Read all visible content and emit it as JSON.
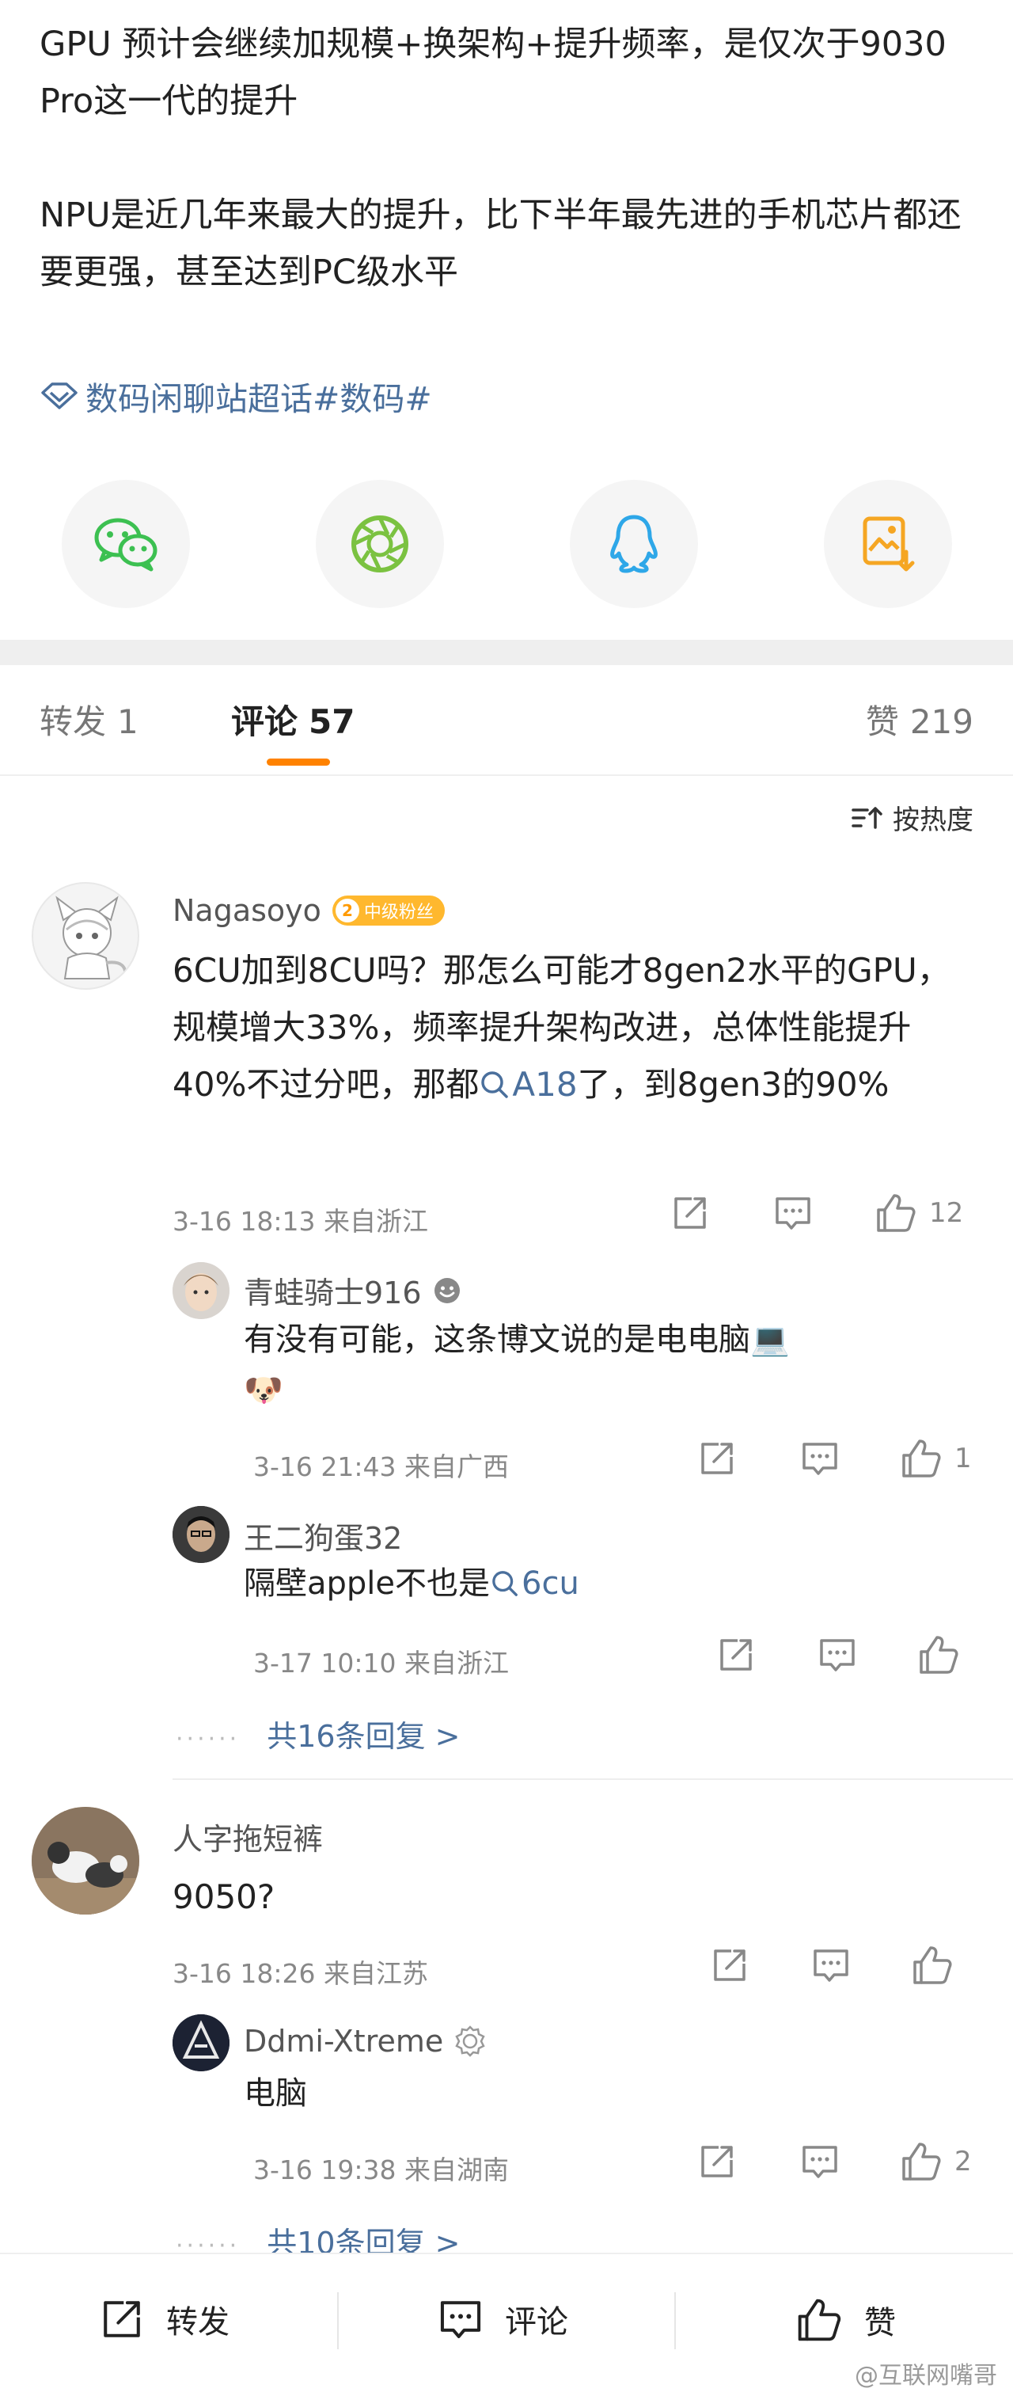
{
  "post": {
    "paragraphs": [
      "GPU 预计会继续加规模+换架构+提升频率，是仅次于9030 Pro这一代的提升",
      "NPU是近几年来最大的提升，比下半年最先进的手机芯片都还要更强，甚至达到PC级水平"
    ],
    "topic": "数码闲聊站超话#数码#",
    "share_targets": [
      "wechat-icon",
      "moments-icon",
      "qq-icon",
      "save-image-icon"
    ]
  },
  "tabs": {
    "repost_label": "转发",
    "repost_count": "1",
    "comment_label": "评论",
    "comment_count": "57",
    "like_label": "赞",
    "like_count": "219"
  },
  "sort": {
    "label": "按热度"
  },
  "comments": [
    {
      "user": "Nagasoyo",
      "badge_level": "2",
      "badge_label": "中级粉丝",
      "text": "6CU加到8CU吗？那怎么可能才8gen2水平的GPU，规模增大33%，频率提升架构改进，总体性能提升40%不过分吧，那都",
      "link_text": "A18",
      "text_after": "了，到8gen3的90%",
      "meta": "3-16 18:13 来自浙江",
      "likes": "12",
      "replies": [
        {
          "user": "青蛙骑士916",
          "text": "有没有可能，这条博文说的是电电脑💻",
          "emoji": "🐶",
          "meta": "3-16 21:43 来自广西",
          "likes": "1"
        },
        {
          "user": "王二狗蛋32",
          "text": "隔壁apple不也是",
          "link_text": "6cu",
          "meta": "3-17 10:10 来自浙江",
          "likes": ""
        }
      ],
      "more_replies": "共16条回复 >"
    },
    {
      "user": "人字拖短裤",
      "text": "9050?",
      "meta": "3-16 18:26 来自江苏",
      "likes": "",
      "replies": [
        {
          "user": "Ddmi-Xtreme",
          "text": "电脑",
          "meta": "3-16 19:38 来自湖南",
          "likes": "2"
        }
      ],
      "more_replies": "共10条回复 >"
    }
  ],
  "bottom_bar": {
    "repost": "转发",
    "comment": "评论",
    "like": "赞"
  },
  "watermark": "@互联网嘴哥",
  "colors": {
    "accent": "#ff8200",
    "link": "#4a6f9c",
    "wechat": "#3cc051",
    "moments": "#7bc241",
    "qq": "#2ea7e8",
    "save": "#f5a623",
    "badge": "#ffb82e"
  }
}
